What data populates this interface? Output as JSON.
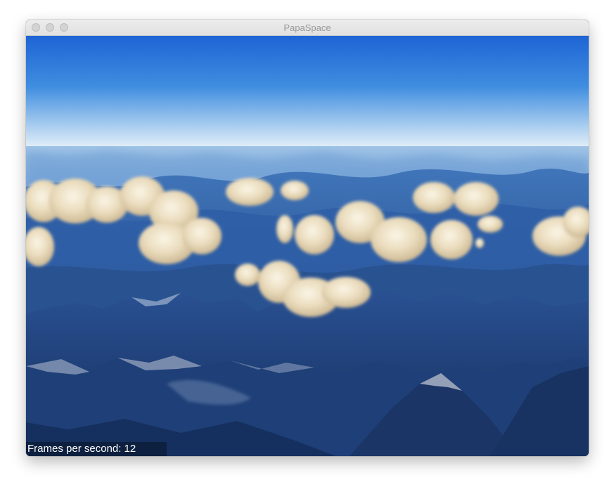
{
  "window": {
    "title": "PapaSpace"
  },
  "overlay": {
    "fps_text": "Frames per second: 12"
  },
  "scene": {
    "sky_top": "#1f6fd9",
    "sky_horizon": "#dfeef8",
    "terrain_color": "#1d3f78",
    "cloud_color": "#f1e6cf"
  }
}
